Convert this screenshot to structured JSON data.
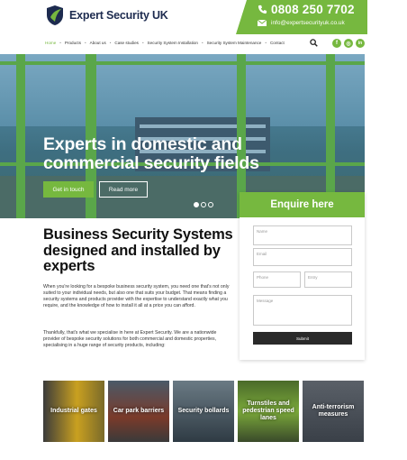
{
  "brand": {
    "name": "Expert Security UK",
    "phone": "0808 250 7702",
    "email": "info@expertsecurityuk.co.uk",
    "accent": "#76b83f",
    "navy": "#1d2b4f"
  },
  "nav": {
    "items": [
      "Home",
      "Products",
      "About us",
      "Case studies",
      "Security System Installation",
      "Security System Maintenance",
      "Contact"
    ]
  },
  "icons": {
    "search": "search-icon",
    "social": [
      "facebook-icon",
      "instagram-icon",
      "linkedin-icon"
    ],
    "social_glyphs": [
      "f",
      "◎",
      "in"
    ]
  },
  "hero": {
    "title": "Experts in domestic and commercial security fields",
    "primary_button": "Get in touch",
    "secondary_button": "Read more",
    "slide_count": 3,
    "active_slide": 1
  },
  "enquire": {
    "title": "Enquire here",
    "fields": {
      "name": "Name",
      "email": "Email",
      "phone": "Phone",
      "entry": "Entry",
      "message": "Message"
    },
    "submit": "Submit"
  },
  "intro": {
    "heading": "Business Security Systems designed and installed by experts",
    "paragraph1": "When you're looking for a bespoke business security system, you need one that's not only suited to your individual needs, but also one that suits your budget. That means finding a security systems and products provider with the expertise to understand exactly what you require, and the knowledge of how to install it all at a price you can afford.",
    "paragraph2": "Thankfully, that's what we specialise in here at Expert Security. We are a nationwide provider of bespoke security solutions for both commercial and domestic properties, specialising in a huge range of security products, including:"
  },
  "tiles": [
    {
      "label": "Industrial gates",
      "colors": [
        "#c9a020",
        "#3b3b3b"
      ]
    },
    {
      "label": "Car park barriers",
      "colors": [
        "#7a3a2a",
        "#4a5a68"
      ]
    },
    {
      "label": "Security bollards",
      "colors": [
        "#5a6a74",
        "#2f3b44"
      ]
    },
    {
      "label": "Turnstiles and pedestrian speed lanes",
      "colors": [
        "#7aa83a",
        "#4a6a2a"
      ]
    },
    {
      "label": "Anti-terrorism measures",
      "colors": [
        "#3a4048",
        "#5a6068"
      ]
    }
  ]
}
